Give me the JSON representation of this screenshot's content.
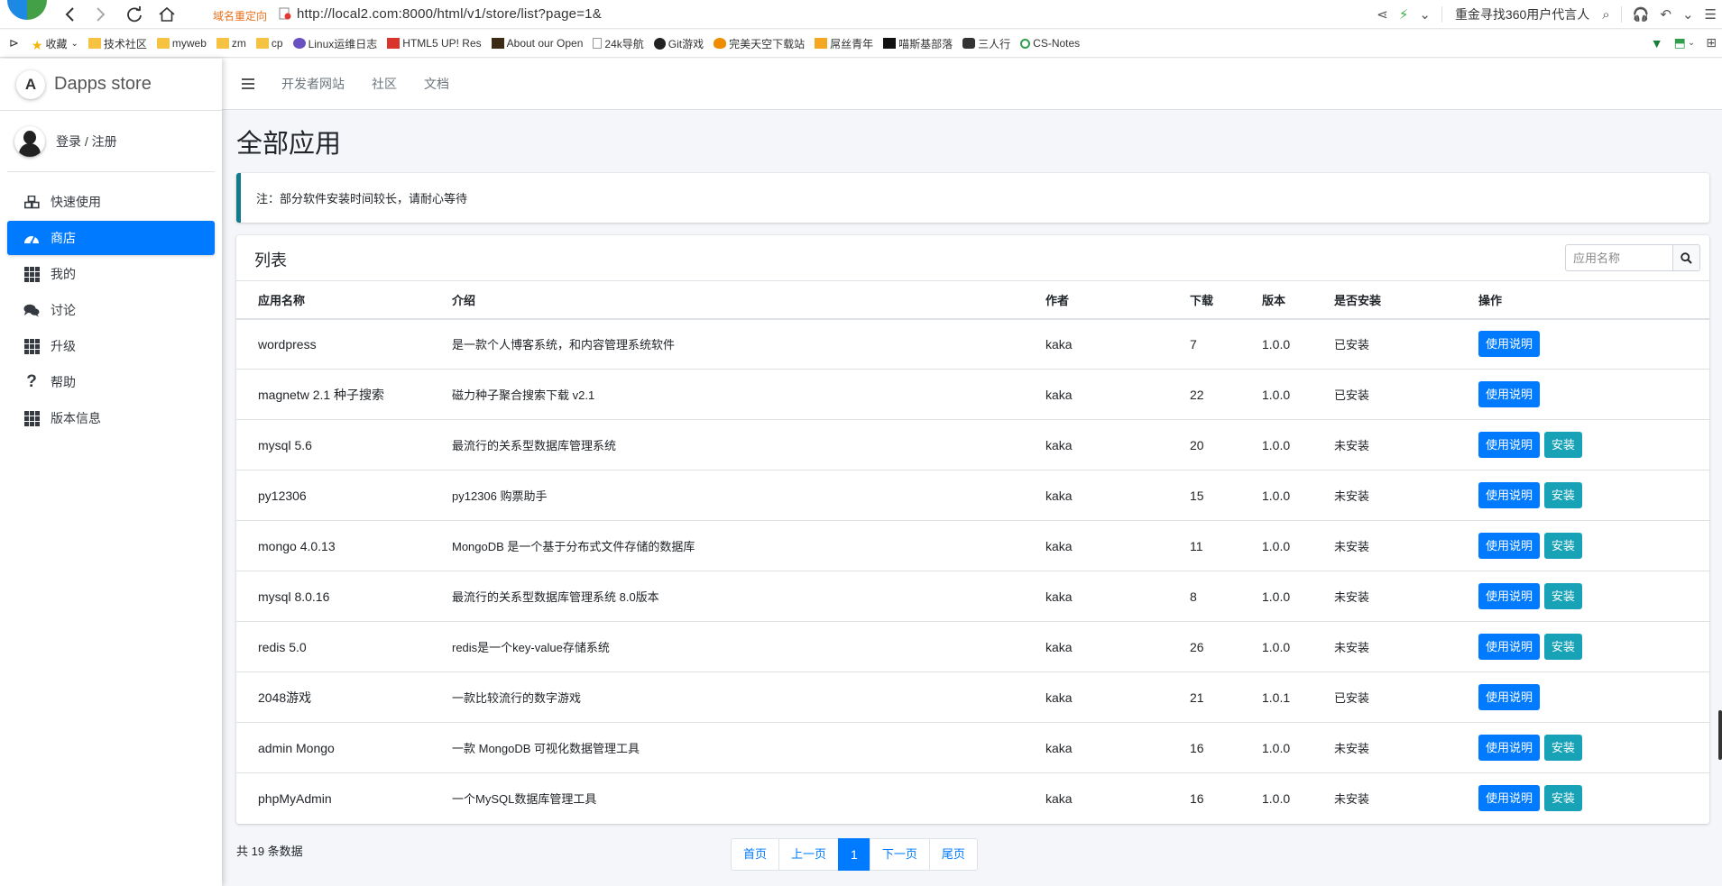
{
  "browser": {
    "domain_redirect": "域名重定向",
    "url": "http://local2.com:8000/html/v1/store/list?page=1&",
    "ad_text": "重金寻找360用户代言人"
  },
  "bookmarks": [
    {
      "label": "收藏",
      "icon": "star-icon"
    },
    {
      "label": "技术社区",
      "icon": "folder-icon"
    },
    {
      "label": "myweb",
      "icon": "folder-icon"
    },
    {
      "label": "zm",
      "icon": "folder-icon"
    },
    {
      "label": "cp",
      "icon": "folder-icon"
    },
    {
      "label": "Linux运维日志",
      "icon": "site-icon"
    },
    {
      "label": "HTML5 UP! Res",
      "icon": "site-icon"
    },
    {
      "label": "About our Open",
      "icon": "site-icon"
    },
    {
      "label": "24k导航",
      "icon": "page-icon"
    },
    {
      "label": "Git游戏",
      "icon": "github-icon"
    },
    {
      "label": "完美天空下载站",
      "icon": "site-icon"
    },
    {
      "label": "屌丝青年",
      "icon": "site-icon"
    },
    {
      "label": "喵斯基部落",
      "icon": "site-icon"
    },
    {
      "label": "三人行",
      "icon": "site-icon"
    },
    {
      "label": "CS-Notes",
      "icon": "site-icon"
    }
  ],
  "sidebar": {
    "brand": "Dapps store",
    "brand_logo": "A",
    "user_link": "登录 / 注册",
    "items": [
      {
        "label": "快速使用",
        "icon": "cubes-icon"
      },
      {
        "label": "商店",
        "icon": "dashboard-icon",
        "active": true
      },
      {
        "label": "我的",
        "icon": "grid-icon"
      },
      {
        "label": "讨论",
        "icon": "comments-icon"
      },
      {
        "label": "升级",
        "icon": "grid-icon"
      },
      {
        "label": "帮助",
        "icon": "question-icon"
      },
      {
        "label": "版本信息",
        "icon": "grid-icon"
      }
    ]
  },
  "topnav": {
    "links": [
      "开发者网站",
      "社区",
      "文档"
    ]
  },
  "main": {
    "title": "全部应用",
    "callout": "注：部分软件安装时间较长，请耐心等待",
    "card_title": "列表",
    "search_placeholder": "应用名称"
  },
  "table": {
    "headers": [
      "应用名称",
      "介绍",
      "作者",
      "下载",
      "版本",
      "是否安装",
      "操作"
    ],
    "rows": [
      {
        "name": "wordpress",
        "desc": "是一款个人博客系统，和内容管理系统软件",
        "author": "kaka",
        "downloads": "7",
        "version": "1.0.0",
        "installed": "已安装",
        "actions": [
          "使用说明"
        ]
      },
      {
        "name": "magnetw 2.1 种子搜索",
        "desc": "磁力种子聚合搜索下载 v2.1",
        "author": "kaka",
        "downloads": "22",
        "version": "1.0.0",
        "installed": "已安装",
        "actions": [
          "使用说明"
        ]
      },
      {
        "name": "mysql 5.6",
        "desc": "最流行的关系型数据库管理系统",
        "author": "kaka",
        "downloads": "20",
        "version": "1.0.0",
        "installed": "未安装",
        "actions": [
          "使用说明",
          "安装"
        ]
      },
      {
        "name": "py12306",
        "desc": "py12306 购票助手",
        "author": "kaka",
        "downloads": "15",
        "version": "1.0.0",
        "installed": "未安装",
        "actions": [
          "使用说明",
          "安装"
        ]
      },
      {
        "name": "mongo 4.0.13",
        "desc": "MongoDB 是一个基于分布式文件存储的数据库",
        "author": "kaka",
        "downloads": "11",
        "version": "1.0.0",
        "installed": "未安装",
        "actions": [
          "使用说明",
          "安装"
        ]
      },
      {
        "name": "mysql 8.0.16",
        "desc": "最流行的关系型数据库管理系统 8.0版本",
        "author": "kaka",
        "downloads": "8",
        "version": "1.0.0",
        "installed": "未安装",
        "actions": [
          "使用说明",
          "安装"
        ]
      },
      {
        "name": "redis 5.0",
        "desc": "redis是一个key-value存储系统",
        "author": "kaka",
        "downloads": "26",
        "version": "1.0.0",
        "installed": "未安装",
        "actions": [
          "使用说明",
          "安装"
        ]
      },
      {
        "name": "2048游戏",
        "desc": "一款比较流行的数字游戏",
        "author": "kaka",
        "downloads": "21",
        "version": "1.0.1",
        "installed": "已安装",
        "actions": [
          "使用说明"
        ]
      },
      {
        "name": "admin Mongo",
        "desc": "一款 MongoDB 可视化数据管理工具",
        "author": "kaka",
        "downloads": "16",
        "version": "1.0.0",
        "installed": "未安装",
        "actions": [
          "使用说明",
          "安装"
        ]
      },
      {
        "name": "phpMyAdmin",
        "desc": "一个MySQL数据库管理工具",
        "author": "kaka",
        "downloads": "16",
        "version": "1.0.0",
        "installed": "未安装",
        "actions": [
          "使用说明",
          "安装"
        ]
      }
    ]
  },
  "footer": {
    "total": "共 19 条数据",
    "pagination": [
      "首页",
      "上一页",
      "1",
      "下一页",
      "尾页"
    ],
    "current_page": "1"
  },
  "colors": {
    "primary": "#007bff",
    "info": "#17a2b8",
    "callout_border": "#117a8b"
  }
}
